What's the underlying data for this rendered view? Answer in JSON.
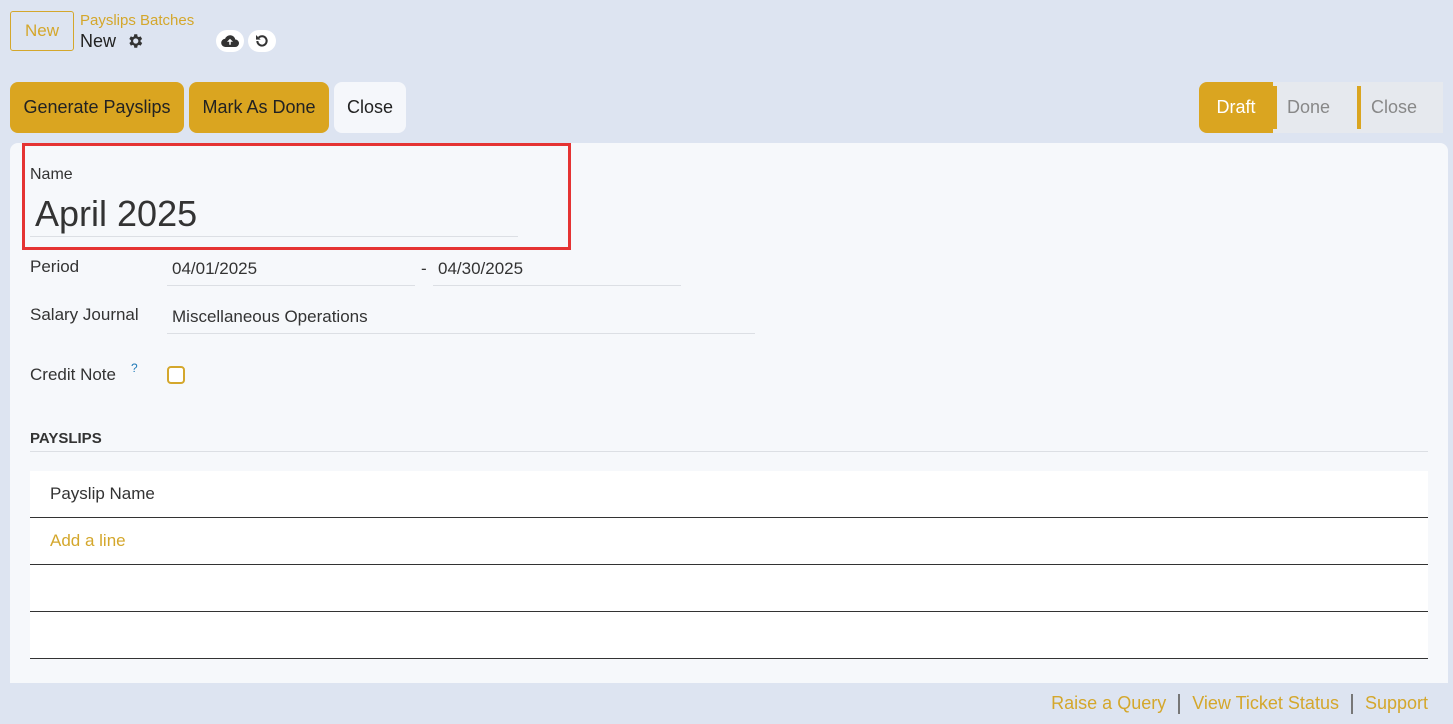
{
  "topbar": {
    "new_label": "New",
    "breadcrumb_parent": "Payslips Batches",
    "breadcrumb_current": "New"
  },
  "actions": {
    "generate_payslips": "Generate Payslips",
    "mark_as_done": "Mark As Done",
    "close": "Close"
  },
  "status": {
    "draft": "Draft",
    "done": "Done",
    "close": "Close"
  },
  "form": {
    "name_label": "Name",
    "name_value": "April 2025",
    "period_label": "Period",
    "period_start": "04/01/2025",
    "period_sep": "-",
    "period_end": "04/30/2025",
    "journal_label": "Salary Journal",
    "journal_value": "Miscellaneous Operations",
    "credit_note_label": "Credit Note",
    "credit_note_help": "?",
    "credit_note_checked": false
  },
  "payslips": {
    "section_title": "PAYSLIPS",
    "column_header": "Payslip Name",
    "add_line": "Add a line"
  },
  "footer": {
    "raise_query": "Raise a Query",
    "view_ticket_status": "View Ticket Status",
    "support": "Support"
  },
  "colors": {
    "accent": "#daa520",
    "background": "#dde4f1",
    "highlight": "#e53333"
  }
}
